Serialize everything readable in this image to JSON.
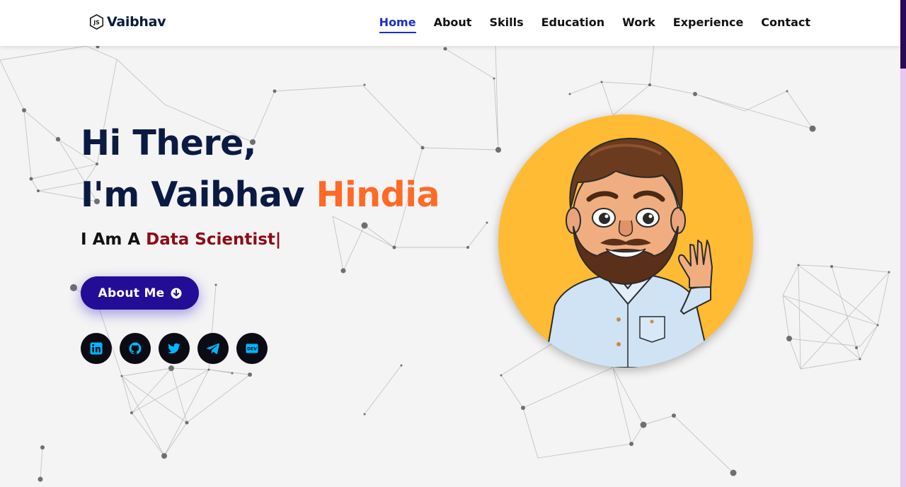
{
  "brand": {
    "name": "Vaibhav",
    "icon": "js-hexagon-icon"
  },
  "nav": {
    "items": [
      {
        "label": "Home",
        "active": true
      },
      {
        "label": "About",
        "active": false
      },
      {
        "label": "Skills",
        "active": false
      },
      {
        "label": "Education",
        "active": false
      },
      {
        "label": "Work",
        "active": false
      },
      {
        "label": "Experience",
        "active": false
      },
      {
        "label": "Contact",
        "active": false
      }
    ]
  },
  "hero": {
    "greeting": "Hi There,",
    "intro_prefix": "I'm Vaibhav ",
    "intro_accent": "Hindia",
    "subtitle_prefix": "I Am A ",
    "subtitle_role": "Data Scientist",
    "cursor": "|"
  },
  "about_button": {
    "label": "About Me",
    "icon": "arrow-down-circle-icon"
  },
  "socials": [
    {
      "name": "linkedin",
      "icon": "linkedin-icon"
    },
    {
      "name": "github",
      "icon": "github-icon"
    },
    {
      "name": "twitter",
      "icon": "twitter-icon"
    },
    {
      "name": "telegram",
      "icon": "telegram-icon"
    },
    {
      "name": "dev",
      "icon": "dev-icon"
    }
  ],
  "avatar": {
    "icon": "cartoon-avatar-waving"
  },
  "colors": {
    "nav_active": "#1a30c7",
    "heading": "#0a1a43",
    "accent": "#ff6a26",
    "role": "#8d0b16",
    "button": "#240d96",
    "social_bg": "#0b0b14",
    "social_fg": "#00b7ff",
    "avatar_bg": "#ffbb33"
  }
}
